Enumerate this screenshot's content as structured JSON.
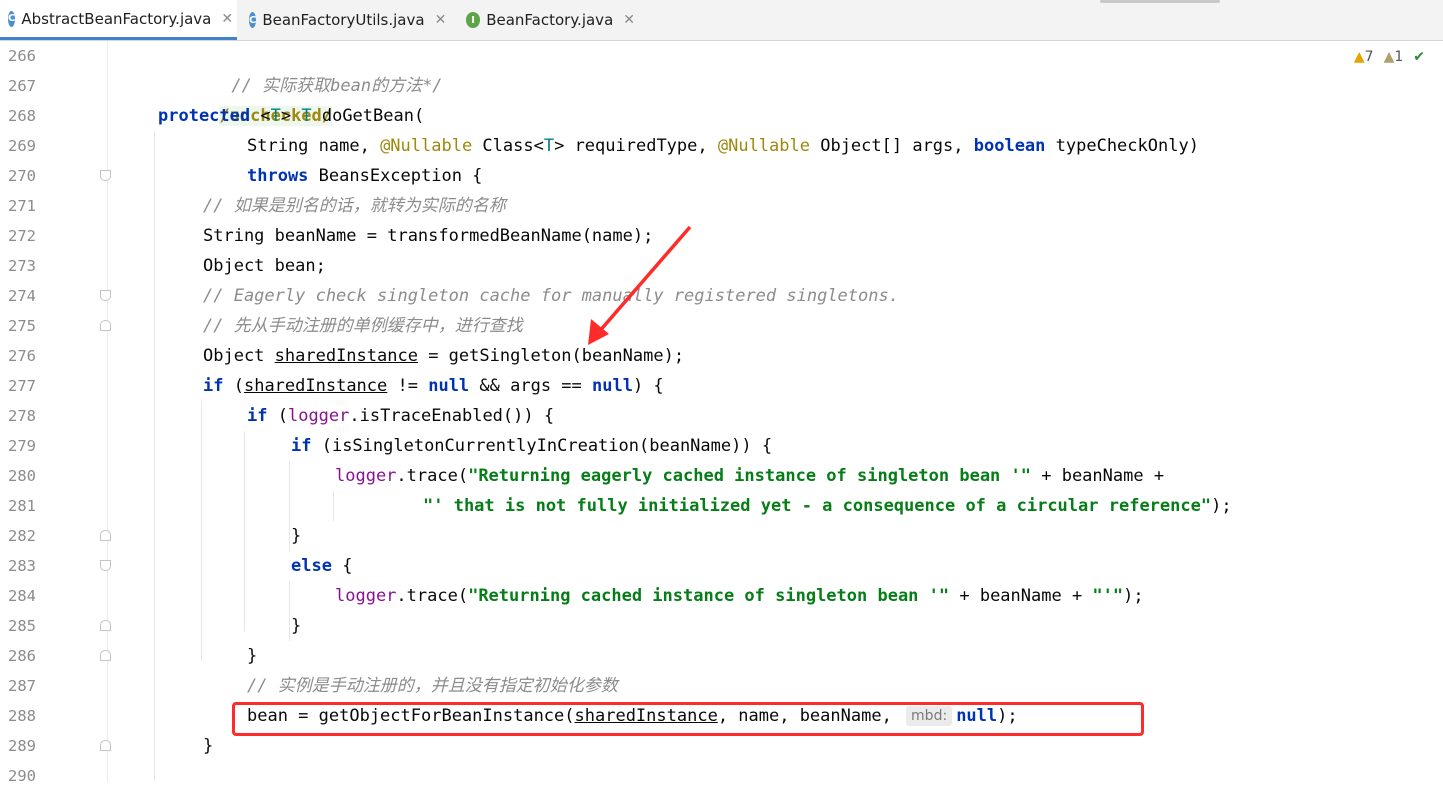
{
  "tabs": [
    {
      "label": "AbstractBeanFactory.java",
      "icon": "C",
      "active": true
    },
    {
      "label": "BeanFactoryUtils.java",
      "icon": "C",
      "active": false
    },
    {
      "label": "BeanFactory.java",
      "icon": "I",
      "active": false
    }
  ],
  "inspections": {
    "warnings": "7",
    "weak_warnings": "1"
  },
  "line_numbers": [
    "266",
    "267",
    "268",
    "269",
    "270",
    "271",
    "272",
    "273",
    "274",
    "275",
    "276",
    "277",
    "278",
    "279",
    "280",
    "281",
    "282",
    "283",
    "284",
    "285",
    "286",
    "287",
    "288",
    "289",
    "290"
  ],
  "code": {
    "l266": "// 实际获取bean的方法*/",
    "l267": "/unchecked/",
    "l268a": "protected",
    "l268b": "<",
    "l268c": "T",
    "l268d": "> ",
    "l268e": "T",
    "l268f": " doGetBean(",
    "l269a": "String name, ",
    "l269b": "@Nullable",
    "l269c": " Class<",
    "l269d": "T",
    "l269e": "> requiredType, ",
    "l269f": "@Nullable",
    "l269g": " Object[] args, ",
    "l269h": "boolean",
    "l269i": " typeCheckOnly)",
    "l270a": "throws",
    "l270b": " BeansException {",
    "l271": "// 如果是别名的话，就转为实际的名称",
    "l272": "String beanName = transformedBeanName(name);",
    "l273": "Object bean;",
    "l274": "// Eagerly check singleton cache for manually registered singletons.",
    "l275": "// 先从手动注册的单例缓存中，进行查找",
    "l276a": "Object ",
    "l276b": "sharedInstance",
    "l276c": " = getSingleton(beanName);",
    "l277a": "if",
    "l277b": " (",
    "l277c": "sharedInstance",
    "l277d": " != ",
    "l277e": "null",
    "l277f": " && args == ",
    "l277g": "null",
    "l277h": ") {",
    "l278a": "if",
    "l278b": " (",
    "l278c": "logger",
    "l278d": ".isTraceEnabled()) {",
    "l279a": "if",
    "l279b": " (isSingletonCurrentlyInCreation(beanName)) {",
    "l280a": "logger",
    "l280b": ".trace(",
    "l280c": "\"Returning eagerly cached instance of singleton bean '\"",
    "l280d": " + beanName +",
    "l281a": "\"' that is not fully initialized yet - a consequence of a circular reference\"",
    "l281b": ");",
    "l282": "}",
    "l283a": "else",
    "l283b": " {",
    "l284a": "logger",
    "l284b": ".trace(",
    "l284c": "\"Returning cached instance of singleton bean '\"",
    "l284d": " + beanName + ",
    "l284e": "\"'\"",
    "l284f": ");",
    "l285": "}",
    "l286": "}",
    "l287": "// 实例是手动注册的，并且没有指定初始化参数",
    "l288a": "bean = getObjectForBeanInstance(",
    "l288b": "sharedInstance",
    "l288c": ", name, beanName, ",
    "l288hint": "mbd:",
    "l288d": "null",
    "l288e": ");",
    "l289": "}"
  },
  "colors": {
    "keyword": "#0033b3",
    "string": "#067d17",
    "comment": "#8c8c8c",
    "annotation": "#9e880d",
    "field": "#871094",
    "highlight_box": "#ff2a2a",
    "arrow": "#ff2a2a"
  }
}
